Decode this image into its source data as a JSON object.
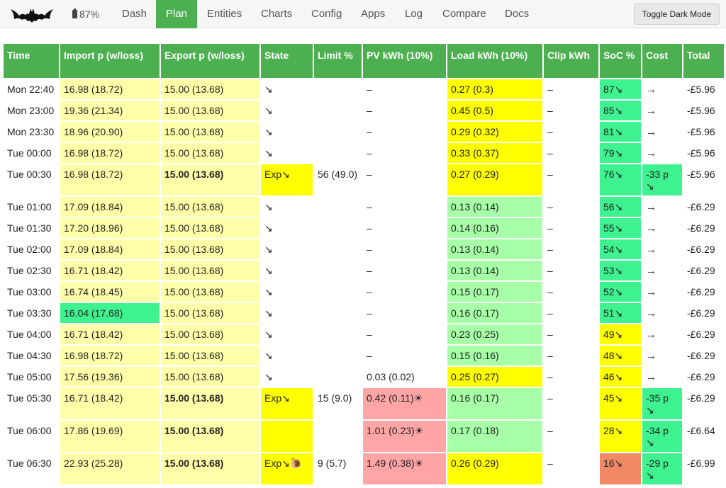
{
  "nav": {
    "battery": "87%",
    "items": [
      "Dash",
      "Plan",
      "Entities",
      "Charts",
      "Config",
      "Apps",
      "Log",
      "Compare",
      "Docs"
    ],
    "active": "Plan",
    "toggle_dark": "Toggle Dark Mode"
  },
  "table": {
    "headers": [
      "Time",
      "Import p (w/loss)",
      "Export p (w/loss)",
      "State",
      "Limit %",
      "PV kWh (10%)",
      "Load kWh (10%)",
      "Clip kWh",
      "SoC %",
      "Cost",
      "Total"
    ],
    "colors": {
      "light_yellow": "#ffffaa",
      "yellow": "#ffff00",
      "green": "#3df28f",
      "light_green": "#a7ffa7",
      "pink": "#ffa5a5",
      "orange": "#f08866",
      "header": "#4caf50"
    },
    "rows": [
      {
        "time": "Mon 22:40",
        "import": "16.98 (18.72)",
        "export": "15.00 (13.68)",
        "state": "↘",
        "limit": "",
        "pv": "–",
        "load": "0.27 (0.3)",
        "clip": "–",
        "soc": "87↘",
        "cost": "→",
        "total": "-£5.96"
      },
      {
        "time": "Mon 23:00",
        "import": "19.36 (21.34)",
        "export": "15.00 (13.68)",
        "state": "↘",
        "limit": "",
        "pv": "–",
        "load": "0.45 (0.5)",
        "clip": "–",
        "soc": "85↘",
        "cost": "→",
        "total": "-£5.96"
      },
      {
        "time": "Mon 23:30",
        "import": "18.96 (20.90)",
        "export": "15.00 (13.68)",
        "state": "↘",
        "limit": "",
        "pv": "–",
        "load": "0.29 (0.32)",
        "clip": "–",
        "soc": "81↘",
        "cost": "→",
        "total": "-£5.96"
      },
      {
        "time": "Tue 00:00",
        "import": "16.98 (18.72)",
        "export": "15.00 (13.68)",
        "state": "↘",
        "limit": "",
        "pv": "–",
        "load": "0.33 (0.37)",
        "clip": "–",
        "soc": "79↘",
        "cost": "→",
        "total": "-£5.96"
      },
      {
        "time": "Tue 00:30",
        "import": "16.98 (18.72)",
        "export": "15.00 (13.68)",
        "state": "Exp↘",
        "limit": "56 (49.0)",
        "pv": "–",
        "load": "0.27 (0.29)",
        "clip": "–",
        "soc": "76↘",
        "cost": "-33 p ↘",
        "total": "-£5.96"
      },
      {
        "time": "Tue 01:00",
        "import": "17.09 (18.84)",
        "export": "15.00 (13.68)",
        "state": "↘",
        "limit": "",
        "pv": "–",
        "load": "0.13 (0.14)",
        "clip": "–",
        "soc": "56↘",
        "cost": "→",
        "total": "-£6.29"
      },
      {
        "time": "Tue 01:30",
        "import": "17.20 (18.96)",
        "export": "15.00 (13.68)",
        "state": "↘",
        "limit": "",
        "pv": "–",
        "load": "0.14 (0.16)",
        "clip": "–",
        "soc": "55↘",
        "cost": "→",
        "total": "-£6.29"
      },
      {
        "time": "Tue 02:00",
        "import": "17.09 (18.84)",
        "export": "15.00 (13.68)",
        "state": "↘",
        "limit": "",
        "pv": "–",
        "load": "0.13 (0.14)",
        "clip": "–",
        "soc": "54↘",
        "cost": "→",
        "total": "-£6.29"
      },
      {
        "time": "Tue 02:30",
        "import": "16.71 (18.42)",
        "export": "15.00 (13.68)",
        "state": "↘",
        "limit": "",
        "pv": "–",
        "load": "0.13 (0.14)",
        "clip": "–",
        "soc": "53↘",
        "cost": "→",
        "total": "-£6.29"
      },
      {
        "time": "Tue 03:00",
        "import": "16.74 (18.45)",
        "export": "15.00 (13.68)",
        "state": "↘",
        "limit": "",
        "pv": "–",
        "load": "0.15 (0.17)",
        "clip": "–",
        "soc": "52↘",
        "cost": "→",
        "total": "-£6.29"
      },
      {
        "time": "Tue 03:30",
        "import": "16.04 (17.68)",
        "export": "15.00 (13.68)",
        "state": "↘",
        "limit": "",
        "pv": "–",
        "load": "0.16 (0.17)",
        "clip": "–",
        "soc": "51↘",
        "cost": "→",
        "total": "-£6.29"
      },
      {
        "time": "Tue 04:00",
        "import": "16.71 (18.42)",
        "export": "15.00 (13.68)",
        "state": "↘",
        "limit": "",
        "pv": "–",
        "load": "0.23 (0.25)",
        "clip": "–",
        "soc": "49↘",
        "cost": "→",
        "total": "-£6.29"
      },
      {
        "time": "Tue 04:30",
        "import": "16.98 (18.72)",
        "export": "15.00 (13.68)",
        "state": "↘",
        "limit": "",
        "pv": "–",
        "load": "0.15 (0.16)",
        "clip": "–",
        "soc": "48↘",
        "cost": "→",
        "total": "-£6.29"
      },
      {
        "time": "Tue 05:00",
        "import": "17.56 (19.36)",
        "export": "15.00 (13.68)",
        "state": "↘",
        "limit": "",
        "pv": "0.03 (0.02)",
        "load": "0.25 (0.27)",
        "clip": "–",
        "soc": "46↘",
        "cost": "→",
        "total": "-£6.29"
      },
      {
        "time": "Tue 05:30",
        "import": "16.71 (18.42)",
        "export": "15.00 (13.68)",
        "state": "Exp↘",
        "limit": "15 (9.0)",
        "pv": "0.42 (0.11)☀",
        "load": "0.16 (0.17)",
        "clip": "–",
        "soc": "45↘",
        "cost": "-35 p ↘",
        "total": "-£6.29"
      },
      {
        "time": "Tue 06:00",
        "import": "17.86 (19.69)",
        "export": "15.00 (13.68)",
        "state": "",
        "limit": "",
        "pv": "1.01 (0.23)☀",
        "load": "0.17 (0.18)",
        "clip": "–",
        "soc": "28↘",
        "cost": "-34 p ↘",
        "total": "-£6.64"
      },
      {
        "time": "Tue 06:30",
        "import": "22.93 (25.28)",
        "export": "15.00 (13.68)",
        "state": "Exp↘🐌",
        "limit": "9 (5.7)",
        "pv": "1.49 (0.38)☀",
        "load": "0.26 (0.29)",
        "clip": "–",
        "soc": "16↘",
        "cost": "-29 p ↘",
        "total": "-£6.99"
      }
    ]
  }
}
